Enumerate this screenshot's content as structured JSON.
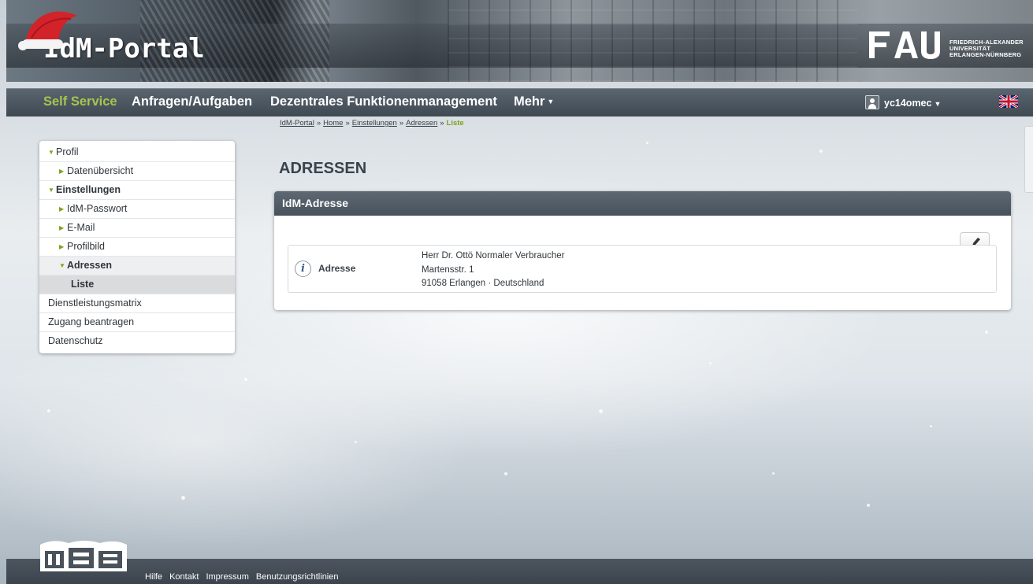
{
  "header": {
    "site_title": "IdM-Portal",
    "logo_line1": "FRIEDRICH-ALEXANDER",
    "logo_line2": "UNIVERSITÄT",
    "logo_line3": "ERLANGEN-NÜRNBERG"
  },
  "nav": {
    "items": [
      {
        "label": "Self Service",
        "active": true
      },
      {
        "label": "Anfragen/Aufgaben"
      },
      {
        "label": "Dezentrales Funktionenmanagement"
      },
      {
        "label": "Mehr"
      }
    ],
    "user": "yc14omec",
    "flag_icon": "uk-flag-icon"
  },
  "breadcrumb": {
    "items": [
      "IdM-Portal",
      "Home",
      "Einstellungen",
      "Adressen"
    ],
    "separator": "»",
    "current": "Liste"
  },
  "sidebar": {
    "items": [
      {
        "label": "Profil"
      },
      {
        "label": "Datenübersicht"
      },
      {
        "label": "Einstellungen"
      },
      {
        "label": "IdM-Passwort"
      },
      {
        "label": "E-Mail"
      },
      {
        "label": "Profilbild"
      },
      {
        "label": "Adressen"
      },
      {
        "label": "Liste"
      },
      {
        "label": "Dienstleistungsmatrix"
      },
      {
        "label": "Zugang beantragen"
      },
      {
        "label": "Datenschutz"
      }
    ]
  },
  "main": {
    "page_title": "ADRESSEN",
    "panel_title": "IdM-Adresse",
    "address": {
      "label": "Adresse",
      "lines": [
        "Herr Dr. Ottö Normaler Verbraucher",
        "Martensstr. 1",
        "91058 Erlangen · Deutschland"
      ]
    }
  },
  "footer": {
    "links": [
      "Hilfe",
      "Kontakt",
      "Impressum",
      "Benutzungsrichtlinien"
    ]
  },
  "colors": {
    "accent_green": "#a4c64d",
    "nav_bg": "#48525c",
    "breadcrumb_current": "#7ea31c"
  }
}
